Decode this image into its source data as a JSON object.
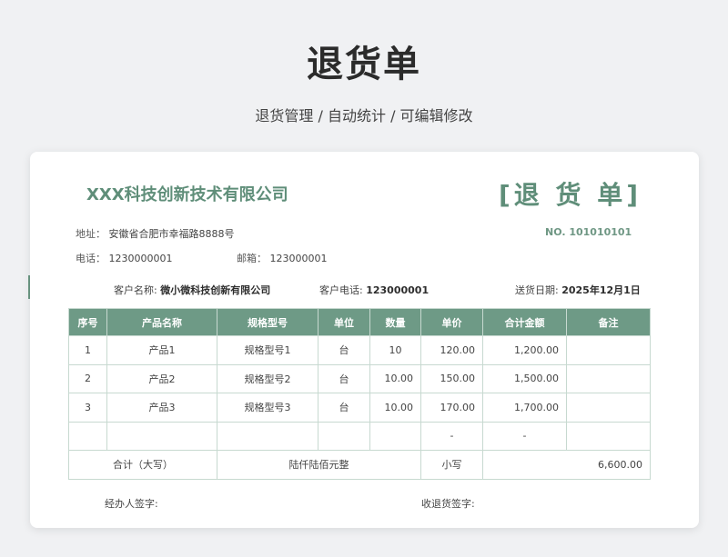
{
  "hero": {
    "title": "退货单",
    "subtitle": "退货管理 / 自动统计 /  可编辑修改"
  },
  "form": {
    "company": "XXX科技创新技术有限公司",
    "doc_title": "[退 货 单]",
    "doc_no": "NO. 101010101",
    "address_label": "地址：",
    "address": "安徽省合肥市幸福路8888号",
    "phone_label": "电话：",
    "phone": "1230000001",
    "postcode_label": "邮箱：",
    "postcode": "123000001",
    "customer_name_label": "客户名称:",
    "customer_name": "微小微科技创新有限公司",
    "customer_phone_label": "客户电话:",
    "customer_phone": "123000001",
    "delivery_date_label": "送货日期:",
    "delivery_date": "2025年12月1日",
    "columns": [
      "序号",
      "产品名称",
      "规格型号",
      "单位",
      "数量",
      "单价",
      "合计金额",
      "备注"
    ],
    "rows": [
      {
        "no": "1",
        "name": "产品1",
        "spec": "规格型号1",
        "unit": "台",
        "qty": "10",
        "price": "120.00",
        "amount": "1,200.00",
        "note": ""
      },
      {
        "no": "2",
        "name": "产品2",
        "spec": "规格型号2",
        "unit": "台",
        "qty": "10.00",
        "price": "150.00",
        "amount": "1,500.00",
        "note": ""
      },
      {
        "no": "3",
        "name": "产品3",
        "spec": "规格型号3",
        "unit": "台",
        "qty": "10.00",
        "price": "170.00",
        "amount": "1,700.00",
        "note": ""
      },
      {
        "no": "",
        "name": "",
        "spec": "",
        "unit": "",
        "qty": "",
        "price": "-",
        "amount": "-",
        "note": ""
      }
    ],
    "total_upper_label": "合计（大写）",
    "total_upper": "陆仟陆佰元整",
    "total_lower_label": "小写",
    "total_lower": "6,600.00",
    "handler_sign_label": "经办人签字:",
    "receiver_sign_label": "收退货签字:"
  }
}
